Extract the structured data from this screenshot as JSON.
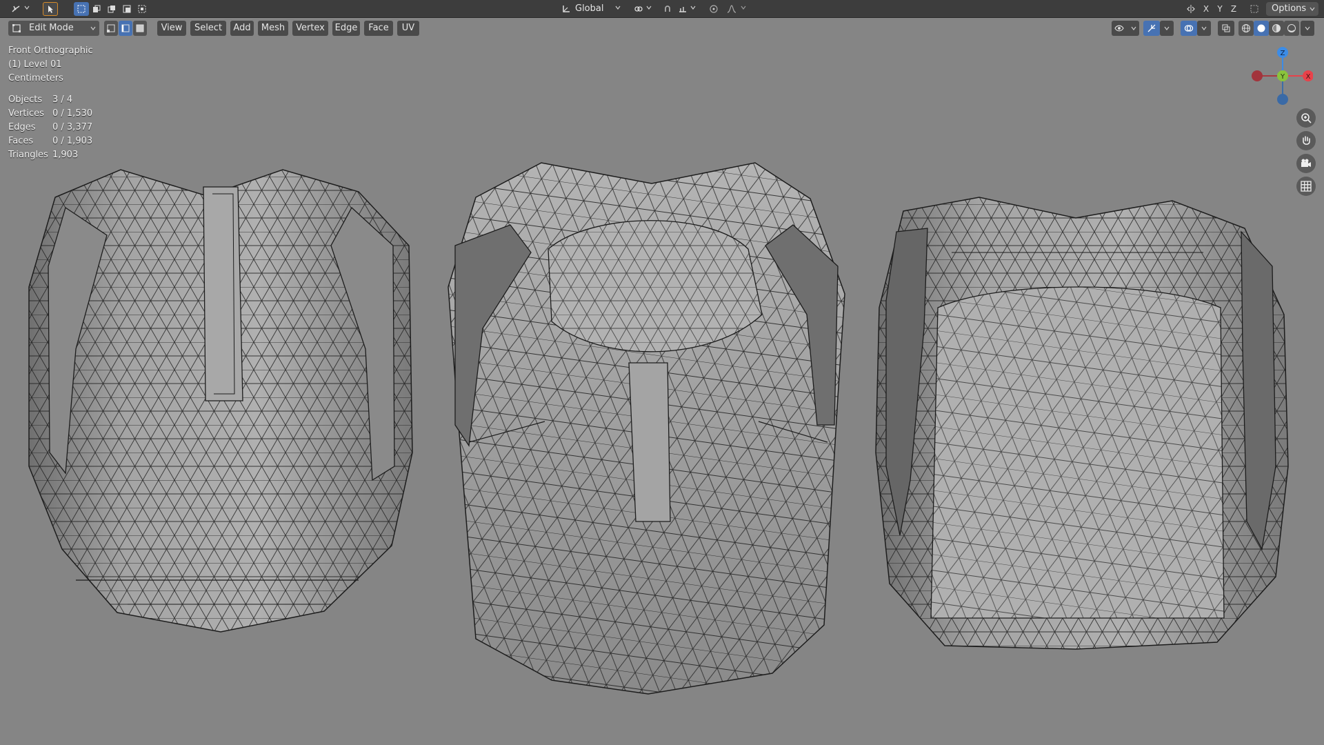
{
  "toolbar": {
    "orientation": "Global",
    "options_label": "Options",
    "axes": [
      "X",
      "Y",
      "Z"
    ]
  },
  "header": {
    "mode": "Edit Mode",
    "menus": [
      "View",
      "Select",
      "Add",
      "Mesh",
      "Vertex",
      "Edge",
      "Face",
      "UV"
    ]
  },
  "overlay": {
    "view_name": "Front Orthographic",
    "collection": "(1) Level 01",
    "units": "Centimeters"
  },
  "stats": [
    {
      "label": "Objects",
      "value": "3 / 4"
    },
    {
      "label": "Vertices",
      "value": "0 / 1,530"
    },
    {
      "label": "Edges",
      "value": "0 / 3,377"
    },
    {
      "label": "Faces",
      "value": "0 / 1,903"
    },
    {
      "label": "Triangles",
      "value": "1,903"
    }
  ],
  "gizmo": {
    "z": "Z",
    "y": "Y",
    "x": "X"
  },
  "colors": {
    "viewport_bg": "#858585",
    "toolbar_bg": "#3d3d3d",
    "button_bg": "#545454",
    "active_blue": "#4772b3",
    "axis_x": "#e8424a",
    "axis_y": "#8ac33c",
    "axis_z": "#3c8ce6"
  },
  "icons": [
    "editor-type-icon",
    "select-tool-icon",
    "select-mode-icons",
    "transform-pivot-icon",
    "snap-icon",
    "proportional-icon",
    "overlay-icon",
    "gizmo-icon",
    "xray-icon",
    "shading-icons",
    "zoom-icon",
    "pan-icon",
    "camera-icon",
    "grid-icon"
  ]
}
